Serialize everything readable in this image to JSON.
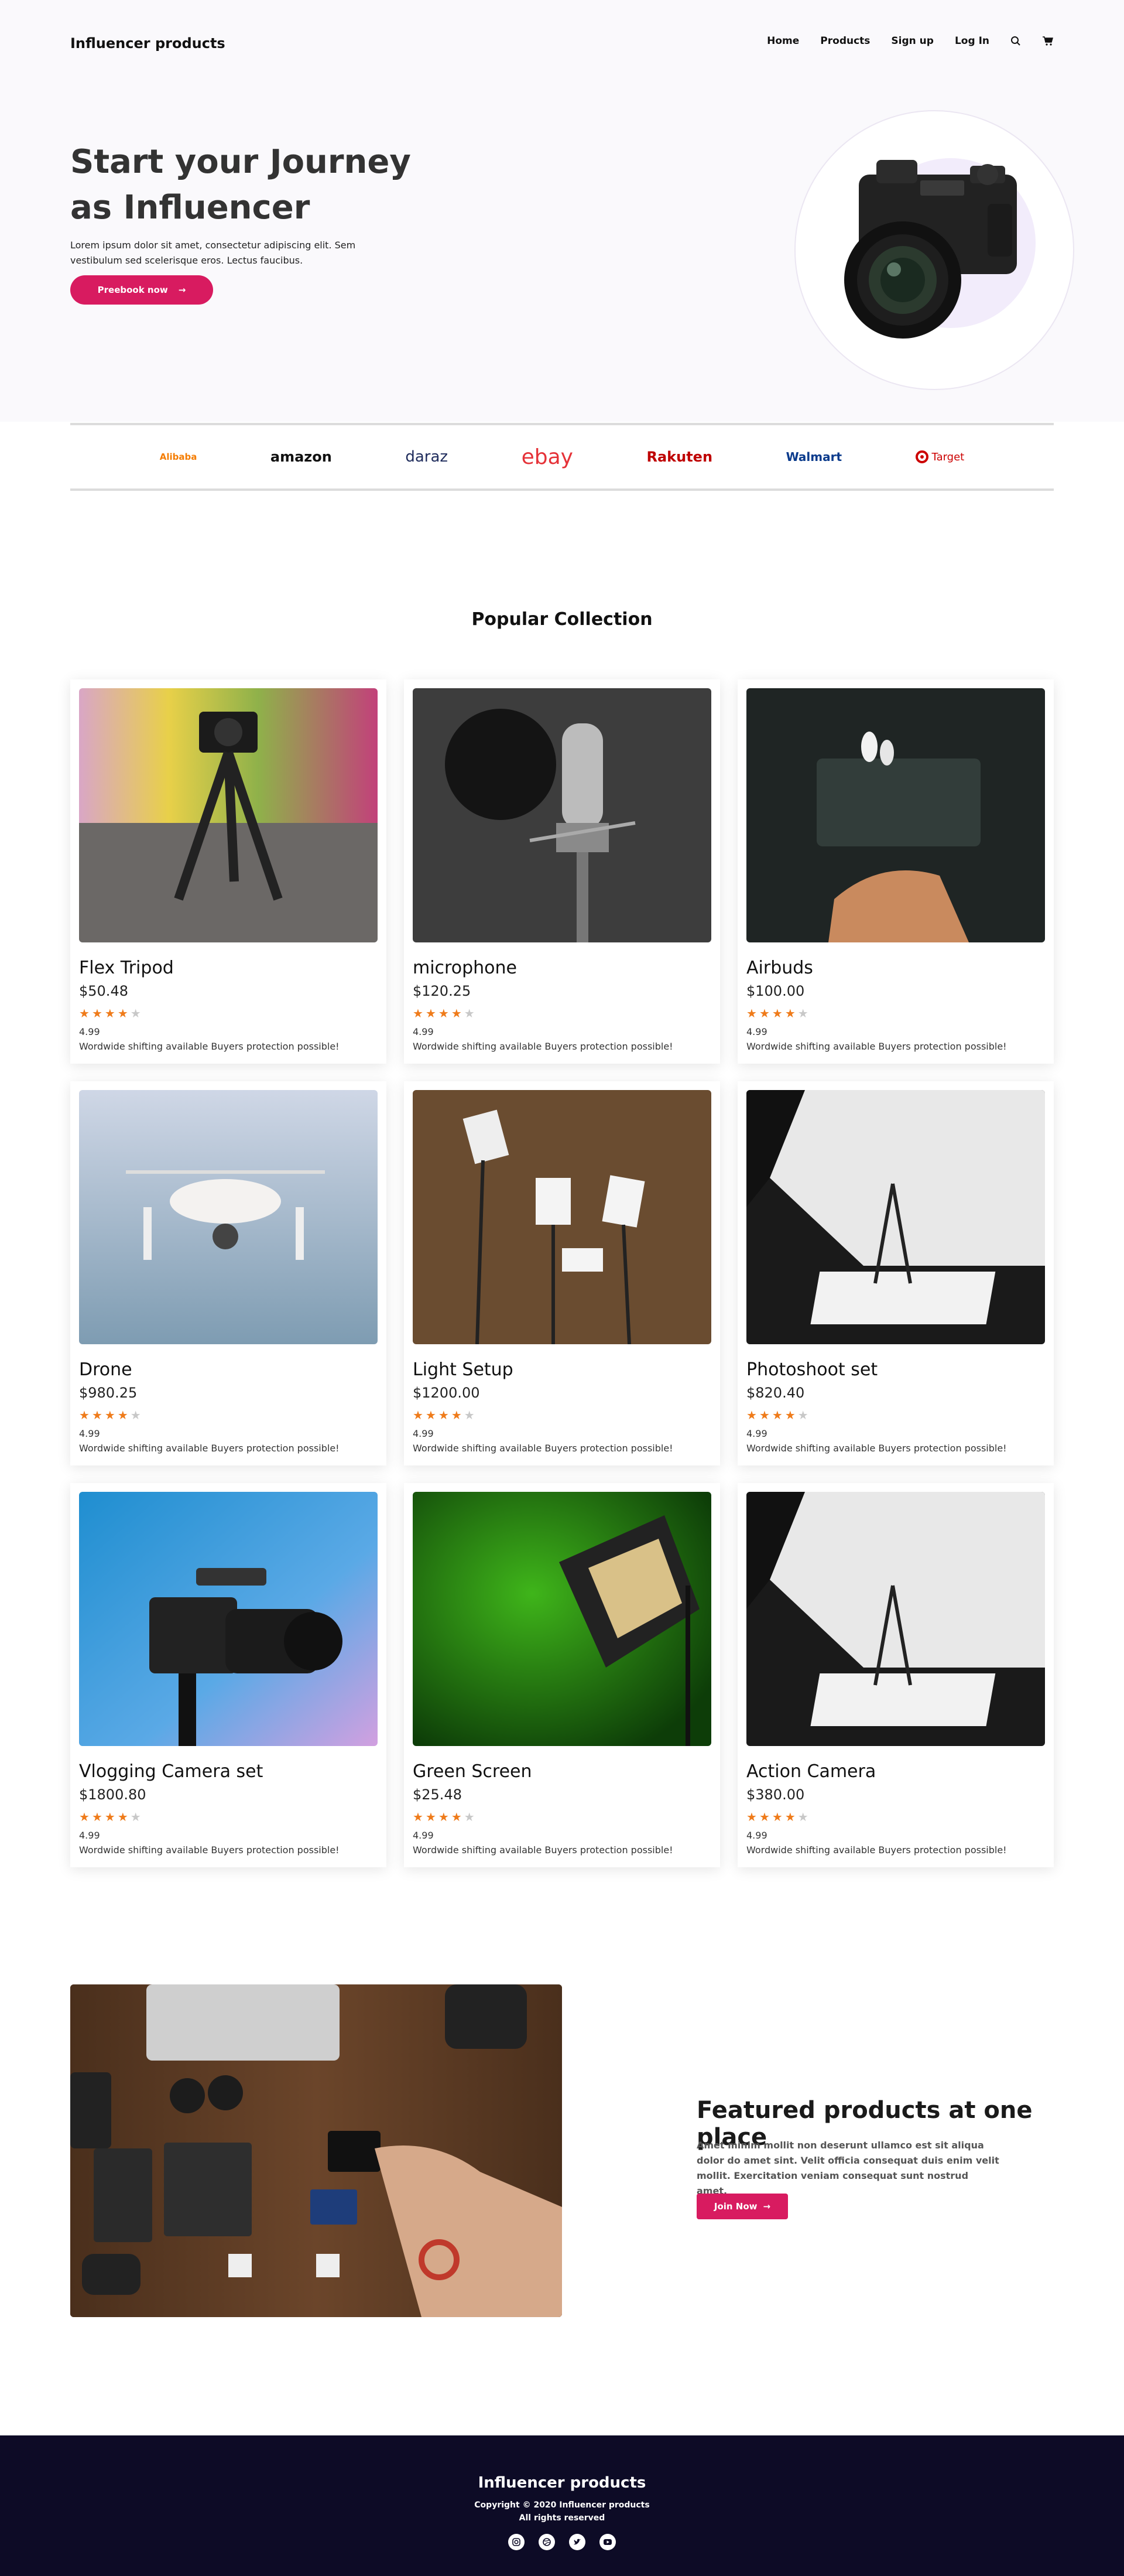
{
  "nav": {
    "brand": "Influencer products",
    "links": [
      "Home",
      "Products",
      "Sign up",
      "Log In"
    ],
    "icons": [
      "search-icon",
      "cart-icon"
    ]
  },
  "hero": {
    "title": "Start your Journey as Influencer",
    "text": "Lorem ipsum dolor sit amet, consectetur adipiscing elit. Sem vestibulum sed scelerisque eros. Lectus faucibus.",
    "button": "Preebook now",
    "image": "camera"
  },
  "brands": [
    {
      "name": "Alibaba",
      "color": "#f57c00"
    },
    {
      "name": "amazon",
      "color": "#111111"
    },
    {
      "name": "daraz",
      "color": "#1f2c5c"
    },
    {
      "name": "ebay",
      "color": "#e53238"
    },
    {
      "name": "Rakuten",
      "color": "#bf0000"
    },
    {
      "name": "Walmart",
      "color": "#0b3b8c"
    },
    {
      "name": "Target",
      "color": "#cc0000"
    }
  ],
  "popular": {
    "title": "Popular Collection",
    "products": [
      {
        "name": "Flex Tripod",
        "price": "$50.48",
        "stars": 4,
        "rating": "4.99",
        "shipping": "Wordwide shifting available Buyers protection possible!"
      },
      {
        "name": "microphone",
        "price": "$120.25",
        "stars": 4,
        "rating": "4.99",
        "shipping": "Wordwide shifting available Buyers protection possible!"
      },
      {
        "name": "Airbuds",
        "price": "$100.00",
        "stars": 4,
        "rating": "4.99",
        "shipping": "Wordwide shifting available Buyers protection possible!"
      },
      {
        "name": "Drone",
        "price": "$980.25",
        "stars": 4,
        "rating": "4.99",
        "shipping": "Wordwide shifting available Buyers protection possible!"
      },
      {
        "name": "Light Setup",
        "price": "$1200.00",
        "stars": 4,
        "rating": "4.99",
        "shipping": "Wordwide shifting available Buyers protection possible!"
      },
      {
        "name": "Photoshoot set",
        "price": "$820.40",
        "stars": 4,
        "rating": "4.99",
        "shipping": "Wordwide shifting available Buyers protection possible!"
      },
      {
        "name": "Vlogging Camera set",
        "price": "$1800.80",
        "stars": 4,
        "rating": "4.99",
        "shipping": "Wordwide shifting available Buyers protection possible!"
      },
      {
        "name": "Green Screen",
        "price": "$25.48",
        "stars": 4,
        "rating": "4.99",
        "shipping": "Wordwide shifting available Buyers protection possible!"
      },
      {
        "name": "Action Camera",
        "price": "$380.00",
        "stars": 4,
        "rating": "4.99",
        "shipping": "Wordwide shifting available Buyers protection possible!"
      }
    ]
  },
  "featured": {
    "title": "Featured products at one place",
    "text": "Amet minim mollit non deserunt ullamco est sit aliqua dolor do amet sint. Velit officia consequat duis enim velit mollit. Exercitation veniam consequat sunt nostrud amet.",
    "button": "Join Now"
  },
  "footer": {
    "brand": "Influencer products",
    "copyright": "Copyright © 2020 Influencer products",
    "rights": "All rights reserved",
    "social": [
      "instagram-icon",
      "dribbble-icon",
      "twitter-icon",
      "youtube-icon"
    ]
  },
  "colors": {
    "accent": "#d81b60",
    "star": "#ef7b1a",
    "footer_bg": "#0d0b26"
  }
}
